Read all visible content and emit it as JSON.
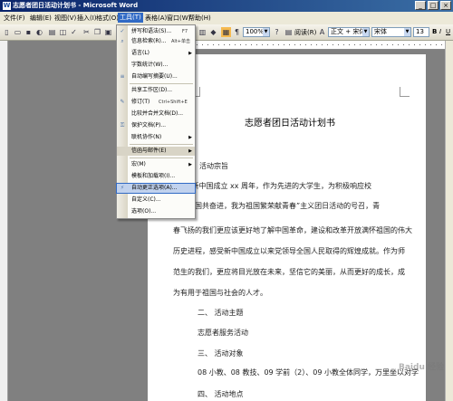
{
  "titlebar": {
    "title": "志愿者团日活动计划书 - Microsoft Word",
    "app_icon": "W"
  },
  "window_controls": {
    "minimize": "_",
    "maximize": "□",
    "close": "×"
  },
  "menubar": {
    "file": "文件(F)",
    "edit": "编辑(E)",
    "view": "视图(V)",
    "insert": "插入(I)",
    "format": "格式(O)",
    "tools": "工具(T)",
    "table": "表格(A)",
    "window": "窗口(W)",
    "help": "帮助(H)"
  },
  "toolbar": {
    "zoom": "100%",
    "read": "阅读(R)",
    "style": "正文 + 宋体",
    "font": "宋体",
    "size": "五号",
    "size_num": "13",
    "font_b": "B",
    "font_i": "I",
    "font_u": "U"
  },
  "tools_menu": {
    "items": [
      {
        "label": "拼写和语法(S)...",
        "shortcut": "F7",
        "icon": "spelling-icon"
      },
      {
        "label": "信息检索(R)...",
        "shortcut": "Alt+单击",
        "icon": "research-icon"
      },
      {
        "label": "语言(L)",
        "shortcut": "",
        "icon": ""
      },
      {
        "label": "字数统计(W)...",
        "shortcut": "",
        "icon": ""
      },
      {
        "label": "自动编写摘要(U)...",
        "shortcut": "",
        "icon": "autosummarize-icon"
      },
      {
        "label": "共享工作区(D)...",
        "shortcut": "",
        "icon": ""
      },
      {
        "label": "修订(T)",
        "shortcut": "Ctrl+Shift+E",
        "icon": "track-changes-icon"
      },
      {
        "label": "比较并合并文档(D)...",
        "shortcut": "",
        "icon": ""
      },
      {
        "label": "保护文档(P)...",
        "shortcut": "",
        "icon": "protect-icon"
      },
      {
        "label": "联机协作(N)",
        "shortcut": "",
        "icon": ""
      },
      {
        "label": "信函与邮件(E)",
        "shortcut": "",
        "icon": ""
      },
      {
        "label": "宏(M)",
        "shortcut": "",
        "icon": ""
      },
      {
        "label": "模板和加载项(I)...",
        "shortcut": "",
        "icon": ""
      },
      {
        "label": "自动更正选项(A)...",
        "shortcut": "",
        "icon": "autocorrect-icon"
      },
      {
        "label": "自定义(C)...",
        "shortcut": "",
        "icon": ""
      },
      {
        "label": "选项(O)...",
        "shortcut": "",
        "icon": ""
      }
    ]
  },
  "document": {
    "title": "志愿者团日活动计划书",
    "lines": [
      "活动宗旨",
      "xxxx 年是新中国成立 xx 周年，作为先进的大学生，为积极响应校",
      "我与祖国共奋进，我为祖国繁荣献青春”主义团日活动的号召，青",
      "春飞扬的我们更应该更好地了解中国革命，建设和改革开放满怀祖国的伟大",
      "历史进程，感受新中国成立以来党领导全国人民取得的辉煌成就。作为师",
      "范生的我们，更应将目光放在未来，坚信它的美丽，从而更好的成长，成",
      "为有用于祖国与社会的人才。",
      "二、 活动主题",
      "志愿者服务活动",
      "三、 活动对象",
      "08 小教、08 教技、09 学前（2）、09 小教全体同学，万里坐以对学",
      "四、 活动地点"
    ]
  },
  "watermark": "Baidu 经验"
}
